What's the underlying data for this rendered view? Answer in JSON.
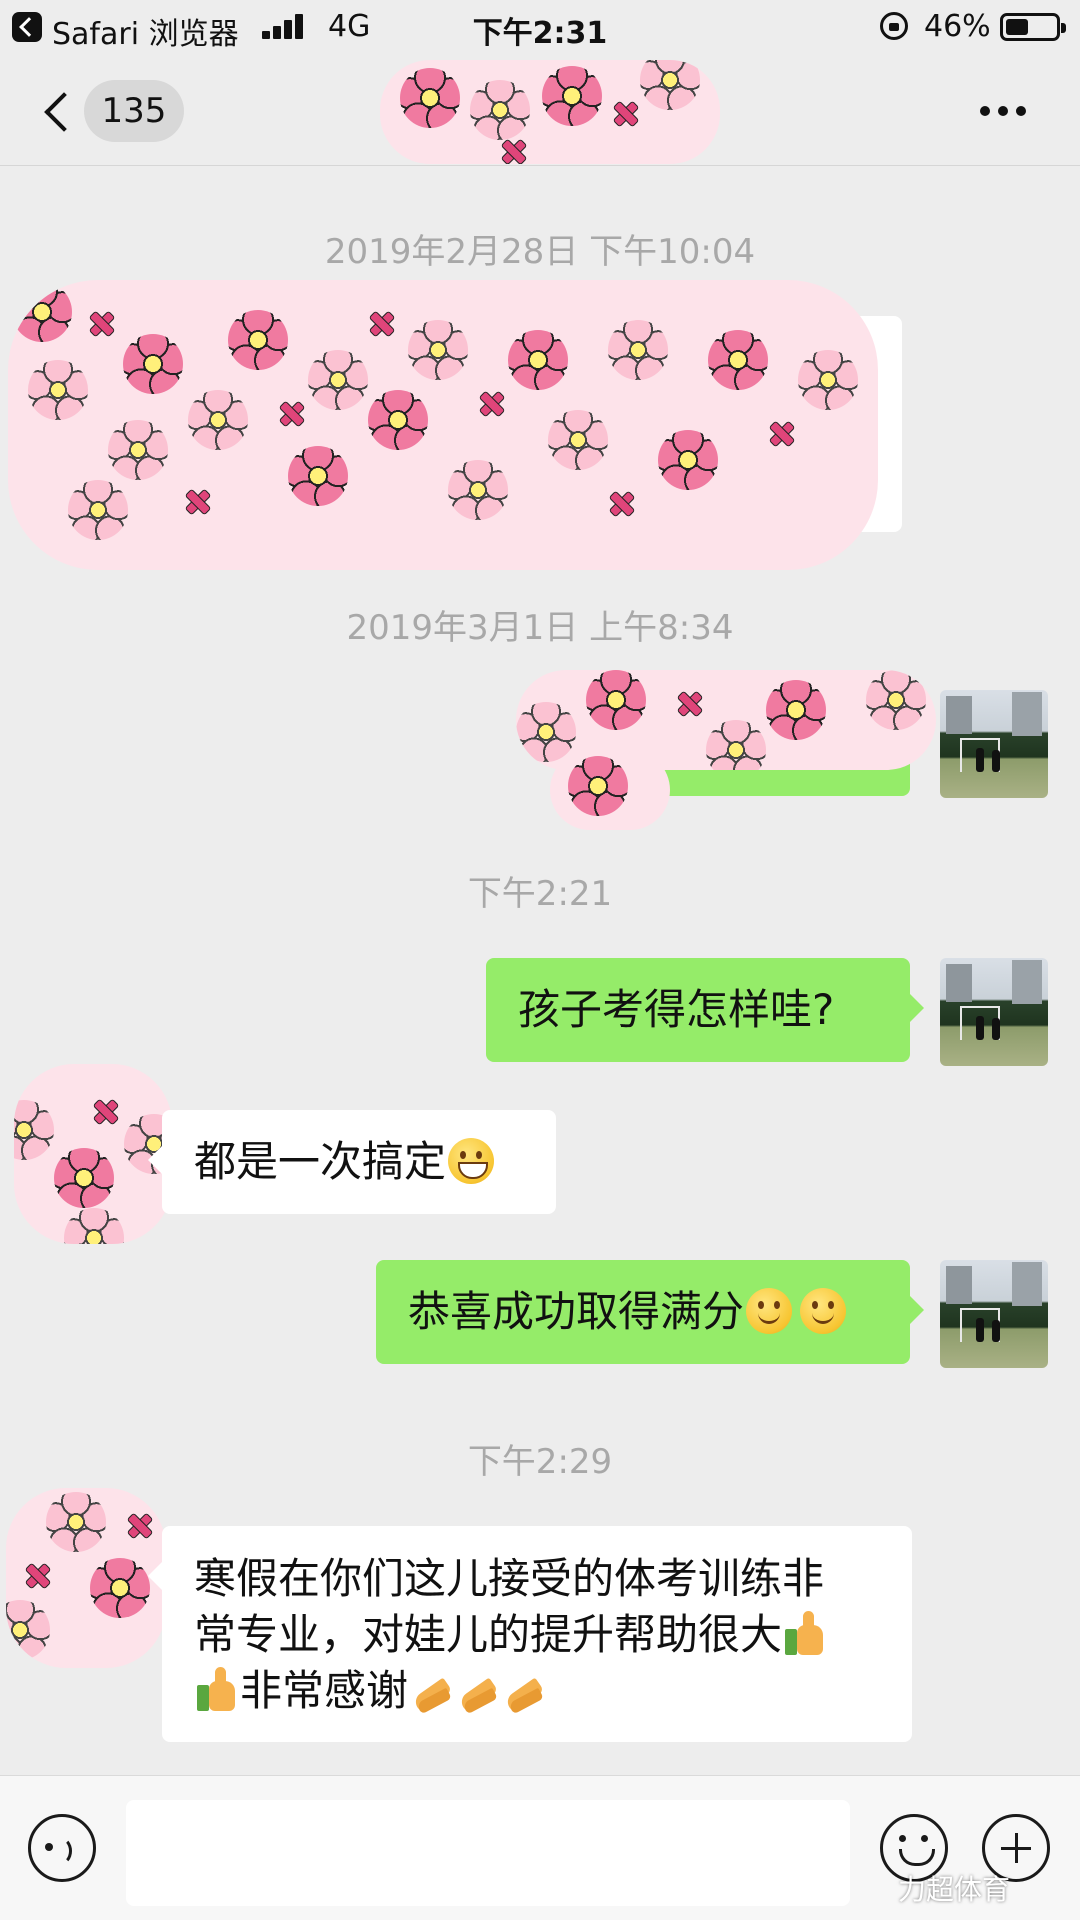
{
  "status_bar": {
    "app_name": "Safari 浏览器",
    "network": "4G",
    "time": "下午2:31",
    "battery_pct": "46%",
    "battery_level": 0.46
  },
  "nav": {
    "unread_count": "135"
  },
  "messages": {
    "ts1": "2019年2月28日 下午10:04",
    "ts2": "2019年3月1日 上午8:34",
    "ts3": "下午2:21",
    "msg_out_1": "孩子考得怎样哇?",
    "msg_in_1": "都是一次搞定",
    "msg_out_2": "恭喜成功取得满分",
    "ts4": "下午2:29",
    "msg_in_2_line1": "寒假在你们这儿接受的体考训练非",
    "msg_in_2_line2": "常专业，对娃儿的提升帮助很大",
    "msg_in_2_line3": "非常感谢"
  },
  "input_bar": {
    "watermark": "力超体育"
  },
  "colors": {
    "background": "#ededed",
    "bubble_out": "#95ec69",
    "bubble_in": "#ffffff",
    "timestamp": "#a8a8a8",
    "censor_bg": "#fde3ea"
  },
  "icons": [
    "back-icon",
    "signal-icon",
    "orientation-lock-icon",
    "battery-icon",
    "chevron-left-icon",
    "more-icon",
    "voice-icon",
    "emoji-icon",
    "plus-icon",
    "grinning-face-emoji",
    "smiling-face-emoji",
    "thumbs-up-emoji",
    "clapping-hands-emoji"
  ]
}
